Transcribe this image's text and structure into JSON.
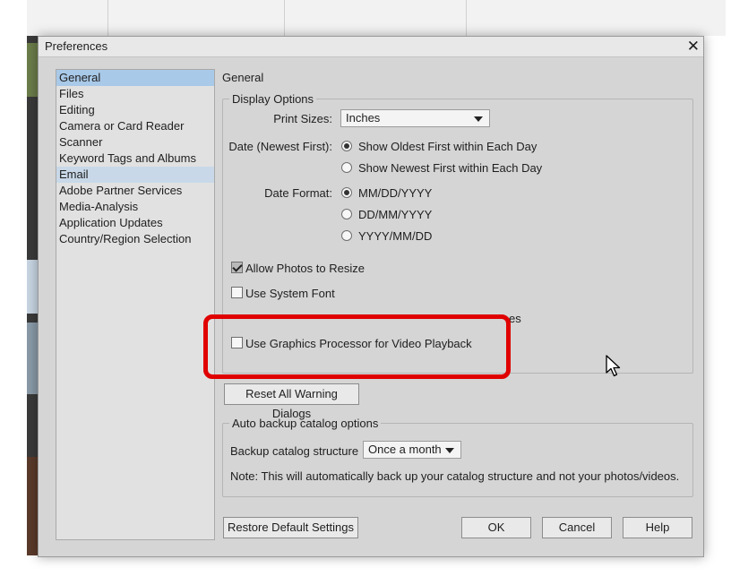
{
  "dialog": {
    "title": "Preferences",
    "close_glyph": "✕"
  },
  "sidebar": {
    "items": [
      {
        "label": "General",
        "selected": true
      },
      {
        "label": "Files"
      },
      {
        "label": "Editing"
      },
      {
        "label": "Camera or Card Reader"
      },
      {
        "label": "Scanner"
      },
      {
        "label": "Keyword Tags and Albums"
      },
      {
        "label": "Email",
        "hover": true
      },
      {
        "label": "Adobe Partner Services"
      },
      {
        "label": "Media-Analysis"
      },
      {
        "label": "Application Updates"
      },
      {
        "label": "Country/Region Selection"
      }
    ]
  },
  "general": {
    "title": "General",
    "display_options": {
      "legend": "Display Options",
      "print_sizes_label": "Print Sizes:",
      "print_sizes_value": "Inches",
      "date_label": "Date (Newest First):",
      "date_options": [
        "Show Oldest First within Each Day",
        "Show Newest First within Each Day"
      ],
      "date_format_label": "Date Format:",
      "date_format_options": [
        "MM/DD/YYYY",
        "DD/MM/YYYY",
        "YYYY/MM/DD"
      ],
      "allow_resize_label": "Allow Photos to Resize",
      "allow_resize_checked": true,
      "system_font_label": "Use System Font",
      "system_font_checked": false,
      "obscured_label_tail": "es",
      "gpu_label": "Use Graphics Processor for Video Playback",
      "gpu_checked": false
    },
    "reset_warnings_label": "Reset All Warning Dialogs",
    "auto_backup": {
      "legend": "Auto backup catalog options",
      "structure_label": "Backup catalog structure",
      "structure_value": "Once a month",
      "note": "Note: This will automatically back up your catalog structure and not your photos/videos."
    }
  },
  "footer": {
    "restore_label": "Restore Default Settings",
    "ok_label": "OK",
    "cancel_label": "Cancel",
    "help_label": "Help"
  },
  "colors": {
    "highlight": "#e00000",
    "selection": "#a9c9e8",
    "dialog_bg": "#d5d5d5"
  }
}
